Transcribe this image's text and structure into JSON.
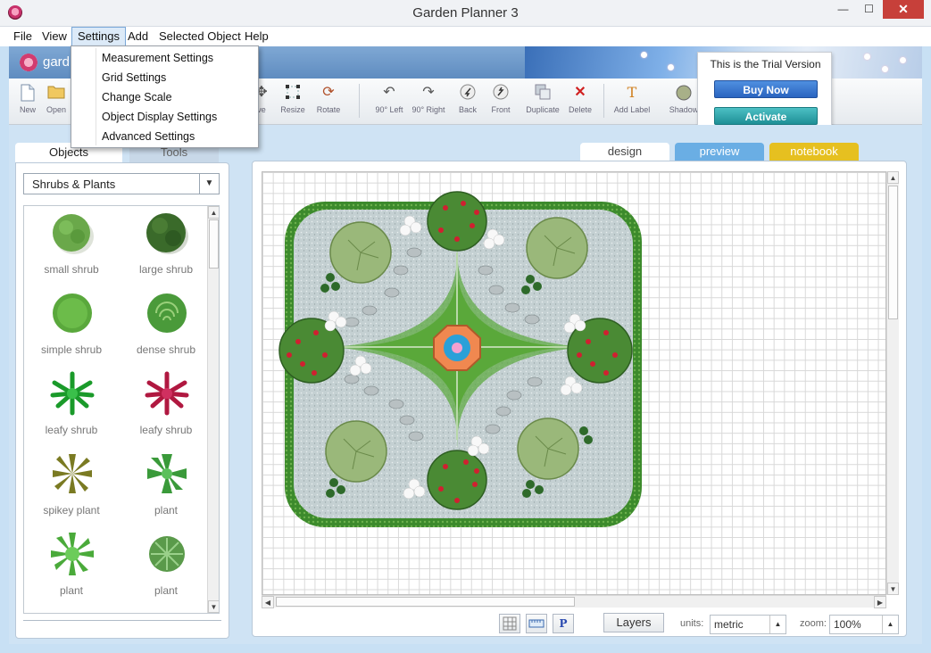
{
  "window": {
    "title": "Garden Planner 3"
  },
  "menu": {
    "items": [
      "File",
      "View",
      "Settings",
      "Add",
      "Selected Object",
      "Help"
    ],
    "open_menu": "Settings",
    "settings_items": [
      "Measurement Settings",
      "Grid Settings",
      "Change Scale",
      "Object Display Settings",
      "Advanced Settings"
    ]
  },
  "banner": {
    "logo_text": "gard"
  },
  "toolbar": {
    "left_tools": [
      {
        "label": "New",
        "icon": "new-document-icon"
      },
      {
        "label": "Open",
        "icon": "open-folder-icon"
      }
    ],
    "middle_tools": [
      {
        "label": "ve",
        "icon": "move-icon"
      },
      {
        "label": "Resize",
        "icon": "resize-icon"
      },
      {
        "label": "Rotate",
        "icon": "rotate-icon"
      },
      {
        "label": "90° Left",
        "icon": "rotate-left-icon"
      },
      {
        "label": "90° Right",
        "icon": "rotate-right-icon"
      },
      {
        "label": "Back",
        "icon": "send-back-icon"
      },
      {
        "label": "Front",
        "icon": "bring-front-icon"
      },
      {
        "label": "Duplicate",
        "icon": "duplicate-icon"
      },
      {
        "label": "Delete",
        "icon": "delete-icon"
      },
      {
        "label": "Add Label",
        "icon": "add-label-icon"
      },
      {
        "label": "Shadow",
        "icon": "shadow-icon"
      }
    ]
  },
  "trial": {
    "message": "This is the Trial Version",
    "buy_label": "Buy Now",
    "activate_label": "Activate",
    "buy_color": "#2a64c0",
    "activate_color": "#1e8f96"
  },
  "left_panel": {
    "tabs": [
      "Objects",
      "Tools"
    ],
    "category": "Shrubs & Plants",
    "plants": [
      {
        "label": "small shrub",
        "icon": "small-shrub-icon"
      },
      {
        "label": "large shrub",
        "icon": "large-shrub-icon"
      },
      {
        "label": "simple shrub",
        "icon": "simple-shrub-icon"
      },
      {
        "label": "dense shrub",
        "icon": "dense-shrub-icon"
      },
      {
        "label": "leafy shrub",
        "icon": "leafy-shrub-green-icon"
      },
      {
        "label": "leafy shrub",
        "icon": "leafy-shrub-red-icon"
      },
      {
        "label": "spikey plant",
        "icon": "spikey-plant-icon"
      },
      {
        "label": "plant",
        "icon": "plant-star-icon"
      },
      {
        "label": "plant",
        "icon": "plant-spiky-icon"
      },
      {
        "label": "plant",
        "icon": "plant-round-icon"
      }
    ]
  },
  "design_tabs": [
    "design",
    "preview",
    "notebook"
  ],
  "design_tab_colors": {
    "preview": "#6aaee4",
    "notebook": "#e6c020"
  },
  "bottom_bar": {
    "layers_label": "Layers",
    "units_label": "units:",
    "units_value": "metric",
    "zoom_label": "zoom:",
    "zoom_value": "100%",
    "p_label": "P"
  }
}
